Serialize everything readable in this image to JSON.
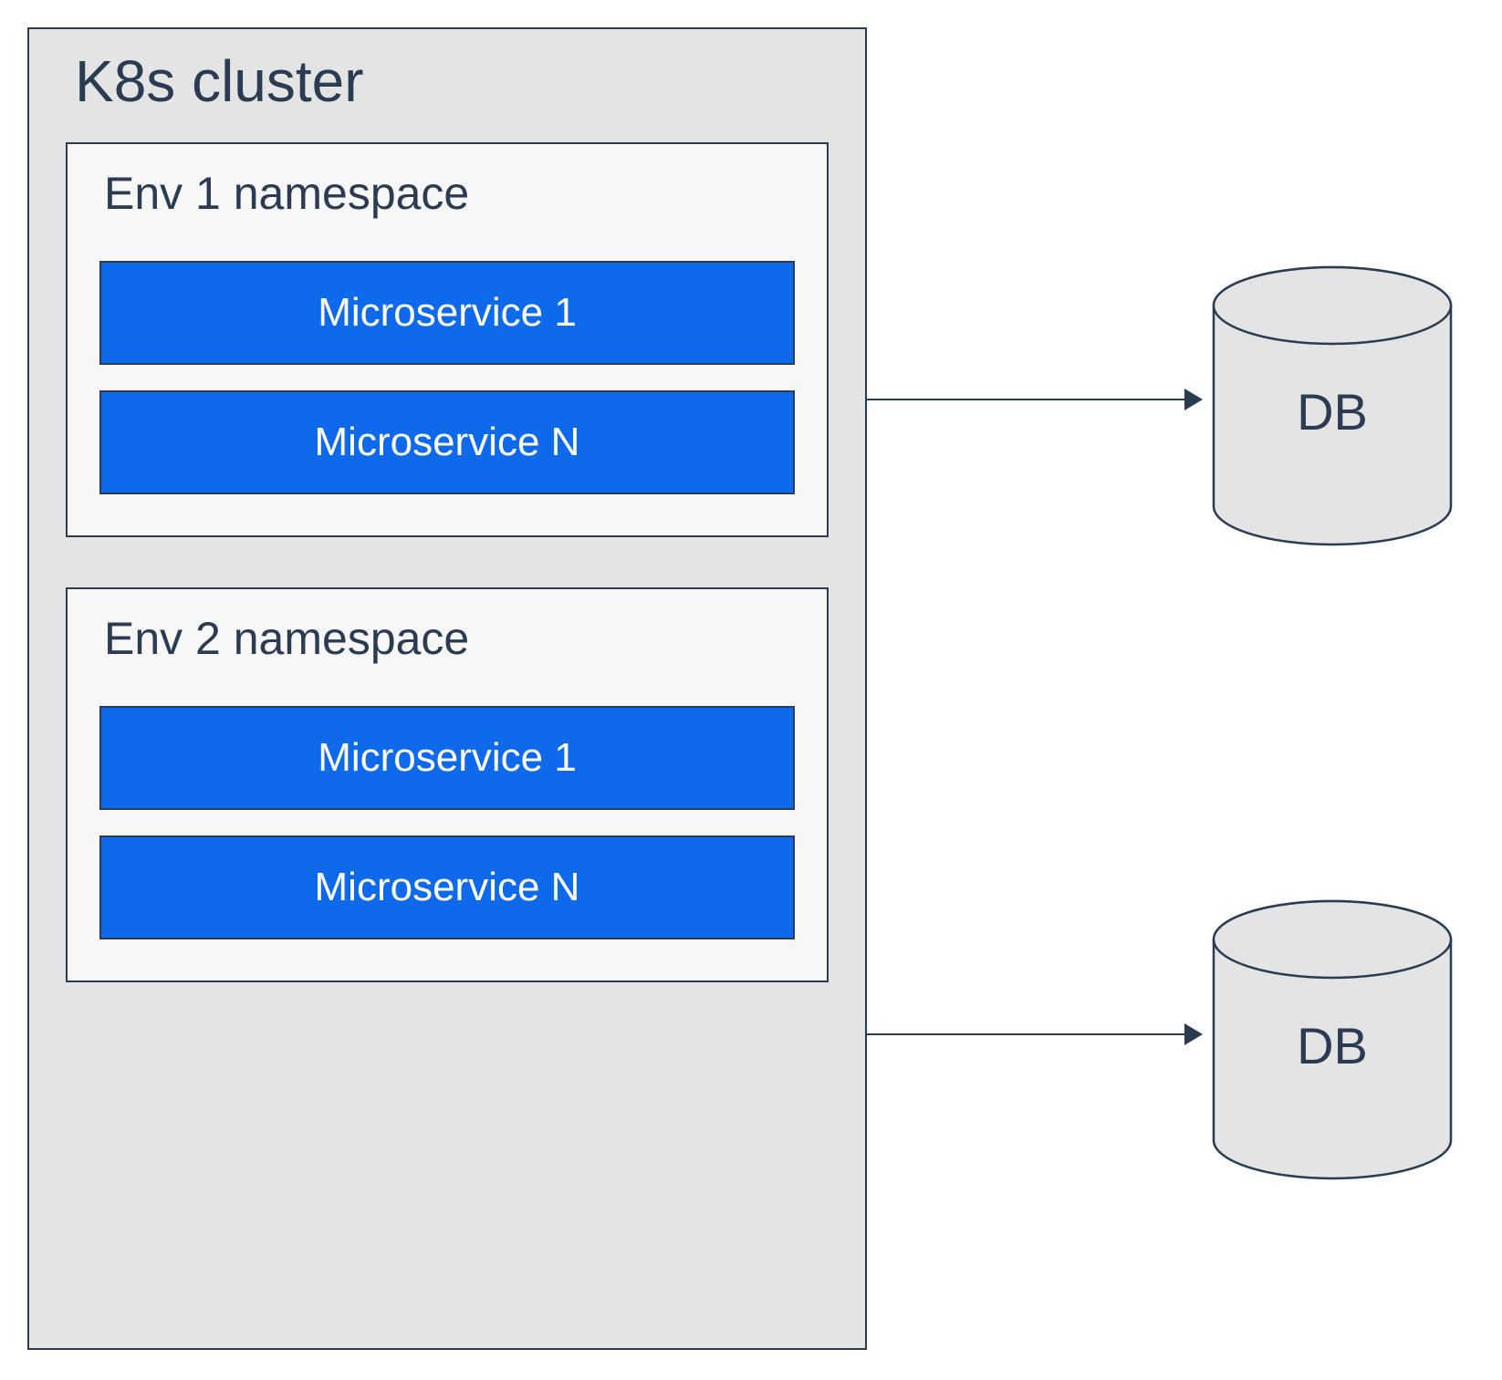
{
  "cluster": {
    "title": "K8s cluster",
    "namespaces": [
      {
        "title": "Env 1 namespace",
        "services": [
          "Microservice 1",
          "Microservice N"
        ]
      },
      {
        "title": "Env 2 namespace",
        "services": [
          "Microservice 1",
          "Microservice N"
        ]
      }
    ]
  },
  "databases": [
    {
      "label": "DB"
    },
    {
      "label": "DB"
    }
  ]
}
